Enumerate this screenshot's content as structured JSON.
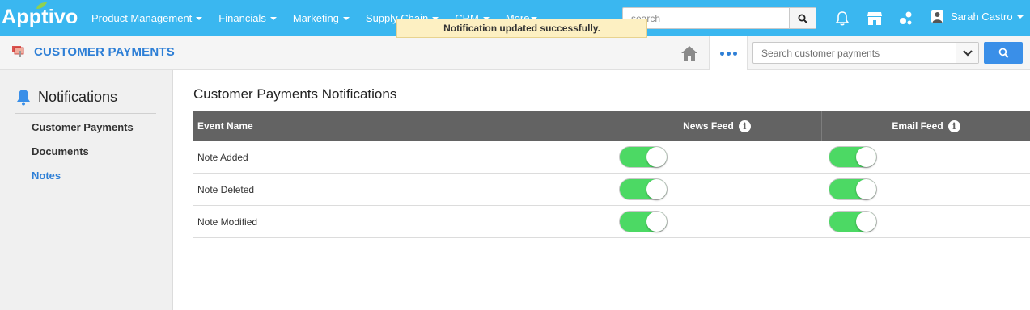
{
  "brand": {
    "name": "Apptivo",
    "accent": "#3ab7f0",
    "primary": "#2e7fd6",
    "toggle_on": "#4cd964"
  },
  "nav": {
    "items": [
      {
        "label": "Product Management",
        "has_caret": true
      },
      {
        "label": "Financials",
        "has_caret": true
      },
      {
        "label": "Marketing",
        "has_caret": true
      },
      {
        "label": "Supply Chain",
        "has_caret": true
      },
      {
        "label": "CRM",
        "has_caret": true
      },
      {
        "label": "More",
        "has_caret": true
      }
    ],
    "search_placeholder": "search",
    "icons": [
      "search-icon",
      "bell-icon",
      "store-icon",
      "apps-icon"
    ],
    "user_name": "Sarah Castro"
  },
  "subheader": {
    "app_title": "CUSTOMER PAYMENTS",
    "toast": "Notification updated successfully.",
    "search_placeholder": "Search customer payments"
  },
  "sidebar": {
    "heading": "Notifications",
    "items": [
      {
        "label": "Customer Payments",
        "active": false
      },
      {
        "label": "Documents",
        "active": false
      },
      {
        "label": "Notes",
        "active": true
      }
    ]
  },
  "main": {
    "title": "Customer Payments Notifications",
    "columns": [
      "Event Name",
      "News Feed",
      "Email Feed"
    ],
    "rows": [
      {
        "event": "Note Added",
        "news_feed": true,
        "email_feed": true
      },
      {
        "event": "Note Deleted",
        "news_feed": true,
        "email_feed": true
      },
      {
        "event": "Note Modified",
        "news_feed": true,
        "email_feed": true
      }
    ]
  }
}
